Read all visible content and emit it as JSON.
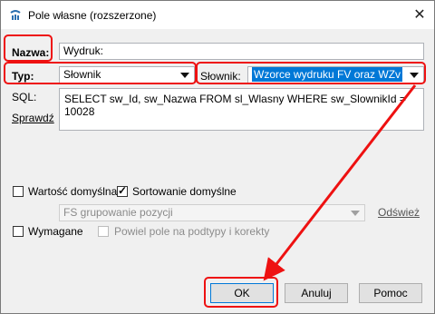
{
  "window": {
    "title": "Pole własne (rozszerzone)",
    "close_glyph": "✕"
  },
  "form": {
    "name_label": "Nazwa:",
    "name_value": "Wydruk:",
    "type_label": "Typ:",
    "type_value": "Słownik",
    "dictionary_label": "Słownik:",
    "dictionary_value": "Wzorce wydruku FV oraz WZv",
    "sql_label": "SQL:",
    "sql_value": "SELECT sw_Id, sw_Nazwa FROM sl_Wlasny WHERE sw_SlownikId = 10028",
    "check_link": "Sprawdź",
    "default_value_label": "Wartość domyślna",
    "default_value_checked": false,
    "default_sort_label": "Sortowanie domyślne",
    "default_sort_checked": true,
    "sort_select_value": "FS grupowanie pozycji",
    "refresh_link": "Odśwież",
    "required_label": "Wymagane",
    "required_checked": false,
    "duplicate_label": "Powiel pole na podtypy i korekty",
    "duplicate_checked": false
  },
  "buttons": {
    "ok": "OK",
    "cancel": "Anuluj",
    "help": "Pomoc"
  },
  "colors": {
    "highlight": "#e11111",
    "selection": "#0078d7",
    "accent_default_button": "#0078d7"
  },
  "icons": {
    "app": "app-logo-icon",
    "close": "close-icon",
    "dropdown": "chevron-down-icon",
    "check": "checkmark-icon"
  }
}
